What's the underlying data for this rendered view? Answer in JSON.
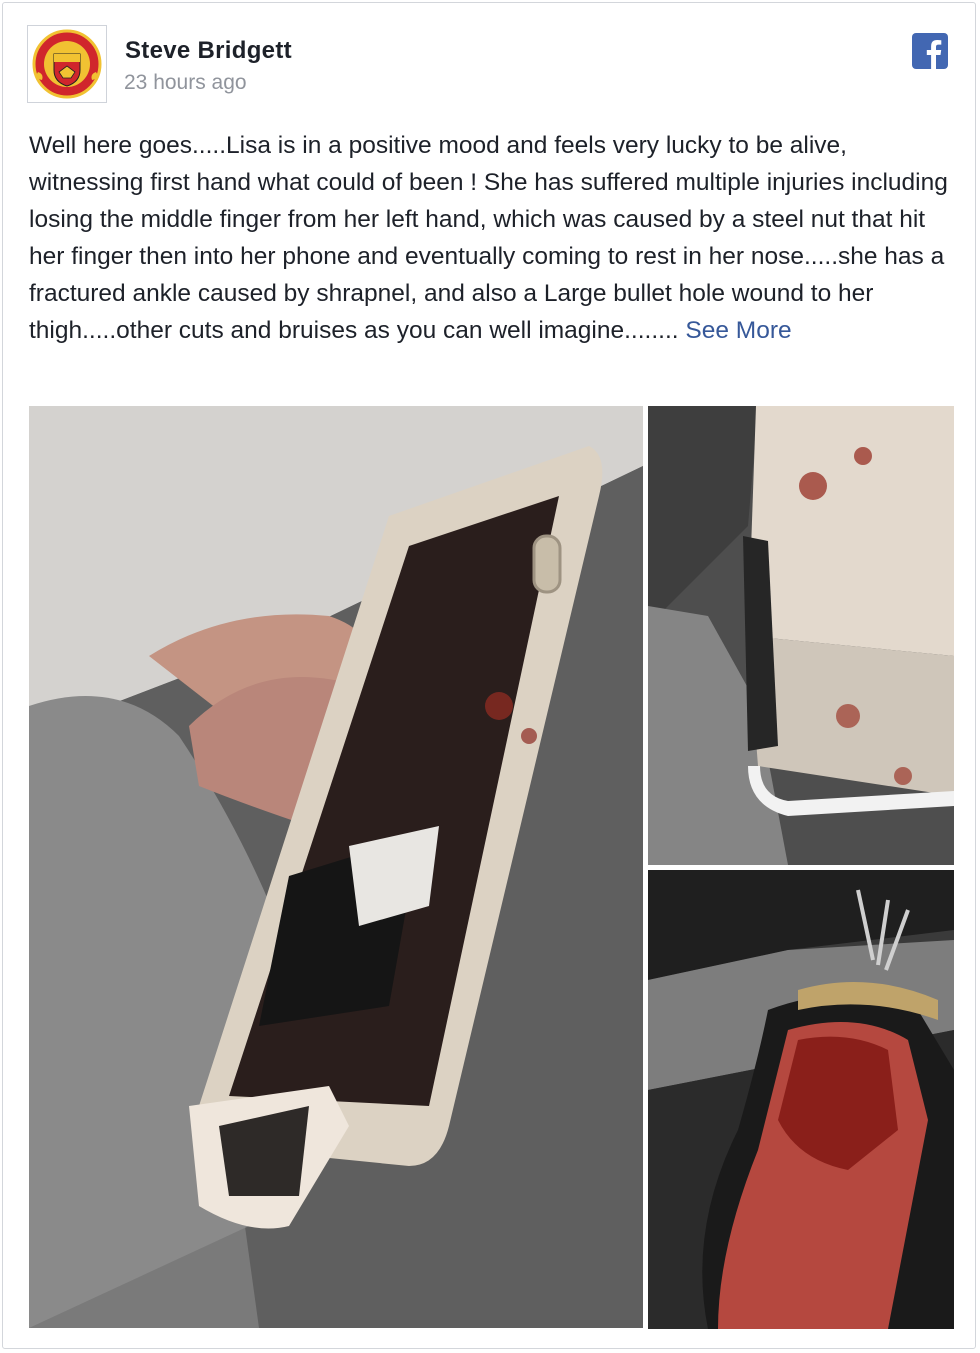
{
  "post": {
    "author": "Steve Bridgett",
    "timestamp": "23 hours ago",
    "body": "Well here goes.....Lisa is in a positive mood and feels very lucky to be alive, witnessing first hand what could of been ! She has suffered multiple injuries including losing the middle finger from her left hand, which was caused by a steel nut that hit her finger then into her phone and eventually coming to rest in her nose.....she has a fractured ankle caused by shrapnel, and also a Large bullet hole wound to her thigh.....other cuts and bruises as you can well imagine........",
    "see_more_label": "See More"
  },
  "icons": {
    "avatar": "manchester-united-crest",
    "platform": "facebook-icon"
  },
  "colors": {
    "facebook_blue": "#4267b2",
    "link": "#365899",
    "meta_gray": "#90949c",
    "text": "#1d2129"
  }
}
